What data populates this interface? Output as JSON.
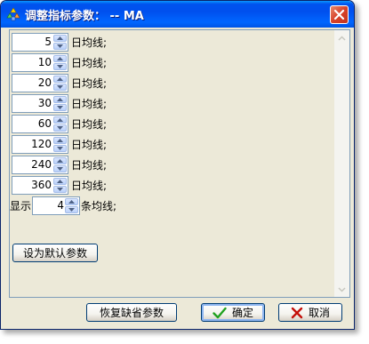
{
  "window": {
    "title": "调整指标参数： -- MA"
  },
  "ma_rows": [
    {
      "value": "5",
      "label": "日均线;"
    },
    {
      "value": "10",
      "label": "日均线;"
    },
    {
      "value": "20",
      "label": "日均线;"
    },
    {
      "value": "30",
      "label": "日均线;"
    },
    {
      "value": "60",
      "label": "日均线;"
    },
    {
      "value": "120",
      "label": "日均线;"
    },
    {
      "value": "240",
      "label": "日均线;"
    },
    {
      "value": "360",
      "label": "日均线;"
    }
  ],
  "display_row": {
    "prefix": "显示",
    "value": "4",
    "suffix": "条均线;"
  },
  "buttons": {
    "set_default": "设为默认参数",
    "restore_default": "恢复缺省参数",
    "ok": "确定",
    "cancel": "取消"
  },
  "colors": {
    "titlebar": "#0055e5",
    "dialog_bg": "#ece9d8",
    "ok_check": "#21a121",
    "cancel_x": "#c4100a"
  }
}
